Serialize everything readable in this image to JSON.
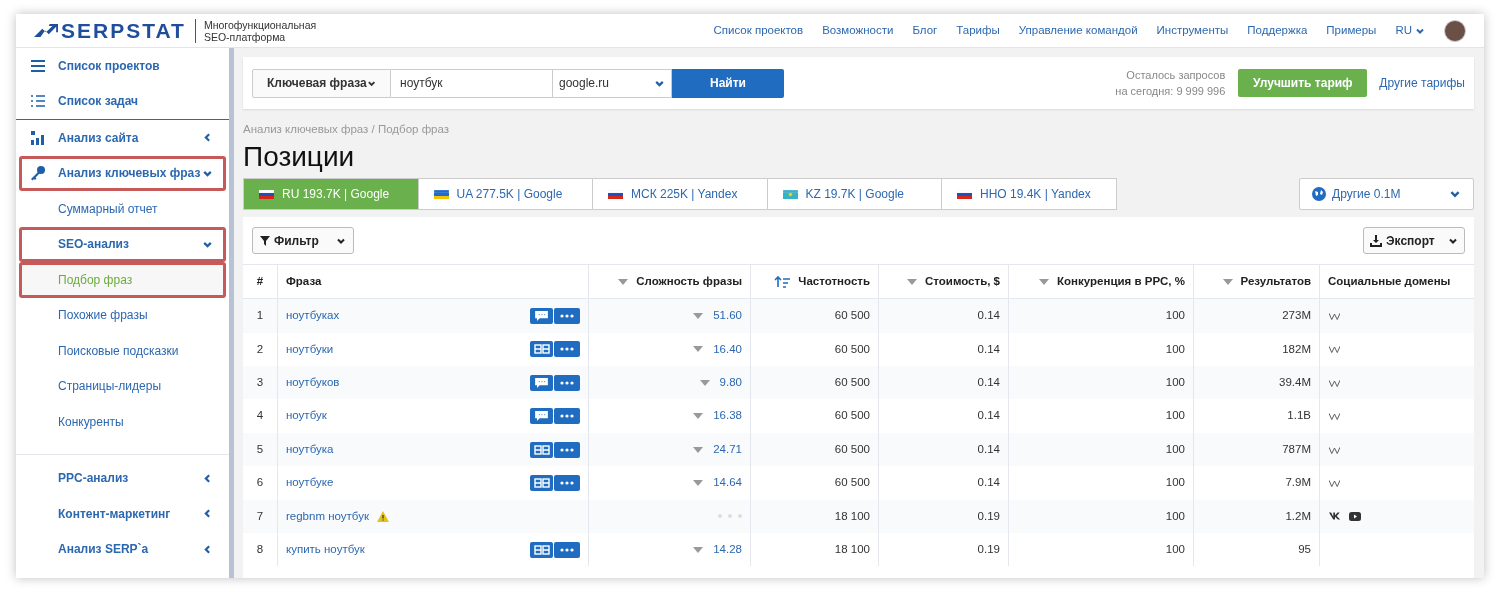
{
  "header": {
    "logo": "SERPSTAT",
    "tagline": "Многофункциональная SEO-платформа",
    "nav": [
      "Список проектов",
      "Возможности",
      "Блог",
      "Тарифы",
      "Управление командой",
      "Инструменты",
      "Поддержка",
      "Примеры"
    ],
    "language": "RU"
  },
  "sidebar": {
    "items": [
      {
        "kind": "top",
        "label": "Список проектов",
        "selected": false,
        "highlighted": false
      },
      {
        "kind": "top",
        "label": "Список задач",
        "selected": false,
        "highlighted": false
      },
      {
        "kind": "section",
        "label": "Анализ сайта",
        "expanded": false,
        "highlighted": false
      },
      {
        "kind": "section",
        "label": "Анализ ключевых фраз",
        "expanded": true,
        "highlighted": true
      },
      {
        "kind": "sub",
        "label": "Суммарный отчет",
        "selected": false,
        "highlighted": false
      },
      {
        "kind": "subsection",
        "label": "SEO-анализ",
        "expanded": true,
        "highlighted": true
      },
      {
        "kind": "sub",
        "label": "Подбор фраз",
        "selected": true,
        "highlighted": true
      },
      {
        "kind": "sub",
        "label": "Похожие фразы",
        "selected": false,
        "highlighted": false
      },
      {
        "kind": "sub",
        "label": "Поисковые подсказки",
        "selected": false,
        "highlighted": false
      },
      {
        "kind": "sub",
        "label": "Страницы-лидеры",
        "selected": false,
        "highlighted": false
      },
      {
        "kind": "sub",
        "label": "Конкуренты",
        "selected": false,
        "highlighted": false
      },
      {
        "kind": "subsection",
        "label": "PPC-анализ",
        "expanded": false,
        "highlighted": false,
        "divider": true
      },
      {
        "kind": "subsection",
        "label": "Контент-маркетинг",
        "expanded": false,
        "highlighted": false
      },
      {
        "kind": "subsection",
        "label": "Анализ SERP`a",
        "expanded": false,
        "highlighted": false
      }
    ]
  },
  "search": {
    "type": "Ключевая фраза",
    "query": "ноутбук",
    "engine": "google.ru",
    "button": "Найти",
    "quota": "Осталось запросов",
    "quota_today": "на сегодня: 9 999 996",
    "upgrade": "Улучшить тариф",
    "other_plans": "Другие тарифы"
  },
  "breadcrumb": "Анализ ключевых фраз / Подбор фраз",
  "title": "Позиции",
  "db_tabs": [
    {
      "label": "RU 193.7K | Google",
      "kind": "ru",
      "selected": true
    },
    {
      "label": "UA 277.5K | Google",
      "kind": "ua",
      "selected": false
    },
    {
      "label": "МСК 225K | Yandex",
      "kind": "ru",
      "selected": false
    },
    {
      "label": "KZ 19.7K | Google",
      "kind": "kz",
      "selected": false
    },
    {
      "label": "ННО 19.4K | Yandex",
      "kind": "ru",
      "selected": false
    }
  ],
  "other_dbs": "Другие 0.1M",
  "filter": "Фильтр",
  "export": "Экспорт",
  "table": {
    "columns": [
      {
        "label": "#",
        "kind": "plain"
      },
      {
        "label": "Фраза",
        "kind": "plain"
      },
      {
        "label": "Сложность фразы",
        "kind": "sortable"
      },
      {
        "label": "Частотность",
        "kind": "sorted"
      },
      {
        "label": "Стоимость, $",
        "kind": "sortable"
      },
      {
        "label": "Конкуренция в PPC, %",
        "kind": "sortable"
      },
      {
        "label": "Результатов",
        "kind": "sortable"
      },
      {
        "label": "Социальные домены",
        "kind": "plain"
      }
    ],
    "rows": [
      {
        "n": "1",
        "phrase": "ноутбуках",
        "kind": "comment",
        "warning": false,
        "difficulty": "51.60",
        "volume": "60 500",
        "cost": "0.14",
        "ppc": "100",
        "results": "273M",
        "social": [
          {
            "kind": "wiki"
          }
        ]
      },
      {
        "n": "2",
        "phrase": "ноутбуки",
        "kind": "compare",
        "warning": false,
        "difficulty": "16.40",
        "volume": "60 500",
        "cost": "0.14",
        "ppc": "100",
        "results": "182M",
        "social": [
          {
            "kind": "wiki"
          }
        ]
      },
      {
        "n": "3",
        "phrase": "ноутбуков",
        "kind": "comment",
        "warning": false,
        "difficulty": "9.80",
        "volume": "60 500",
        "cost": "0.14",
        "ppc": "100",
        "results": "39.4M",
        "social": [
          {
            "kind": "wiki"
          }
        ]
      },
      {
        "n": "4",
        "phrase": "ноутбук",
        "kind": "comment",
        "warning": false,
        "difficulty": "16.38",
        "volume": "60 500",
        "cost": "0.14",
        "ppc": "100",
        "results": "1.1B",
        "social": [
          {
            "kind": "wiki"
          }
        ]
      },
      {
        "n": "5",
        "phrase": "ноутбука",
        "kind": "compare",
        "warning": false,
        "difficulty": "24.71",
        "volume": "60 500",
        "cost": "0.14",
        "ppc": "100",
        "results": "787M",
        "social": [
          {
            "kind": "wiki"
          }
        ]
      },
      {
        "n": "6",
        "phrase": "ноутбуке",
        "kind": "compare",
        "warning": false,
        "difficulty": "14.64",
        "volume": "60 500",
        "cost": "0.14",
        "ppc": "100",
        "results": "7.9M",
        "social": [
          {
            "kind": "wiki"
          }
        ]
      },
      {
        "n": "7",
        "phrase": "regbnm ноутбук",
        "kind": "pending",
        "warning": true,
        "volume": "18 100",
        "cost": "0.19",
        "ppc": "100",
        "results": "1.2M",
        "social": [
          {
            "kind": "vk"
          },
          {
            "kind": "video"
          }
        ]
      },
      {
        "n": "8",
        "phrase": "купить ноутбук",
        "kind": "compare",
        "warning": false,
        "difficulty": "14.28",
        "volume": "18 100",
        "cost": "0.19",
        "ppc": "100",
        "results": "95"
      }
    ]
  }
}
